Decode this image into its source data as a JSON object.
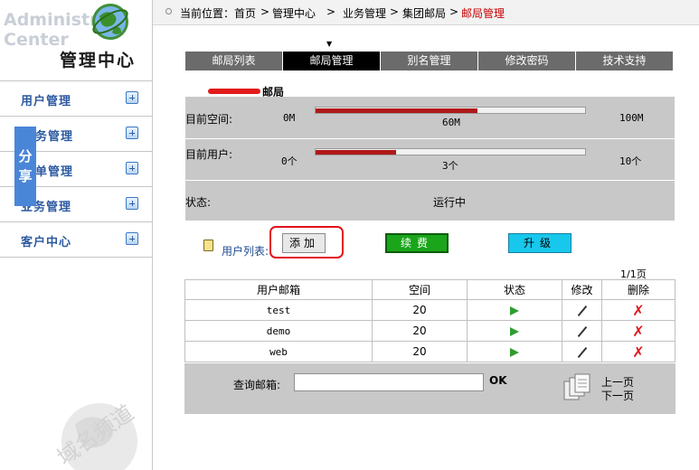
{
  "sidebar": {
    "logo_text_line1": "Administr",
    "logo_text_line2": "Center",
    "logo_title": "管理中心",
    "items": [
      {
        "label": "用户管理"
      },
      {
        "label": "务管理"
      },
      {
        "label": "单管理"
      },
      {
        "label": "业务管理"
      },
      {
        "label": "客户中心"
      }
    ],
    "share_label_1": "分",
    "share_label_2": "享",
    "watermark_text": "域名频道"
  },
  "breadcrumb": {
    "prefix": "当前位置：",
    "items": [
      "首页",
      "管理中心",
      "业务管理",
      "集团邮局"
    ],
    "separator": ">",
    "current": "邮局管理"
  },
  "tabs": [
    {
      "label": "邮局列表",
      "active": false
    },
    {
      "label": "邮局管理",
      "active": true
    },
    {
      "label": "别名管理",
      "active": false
    },
    {
      "label": "修改密码",
      "active": false
    },
    {
      "label": "技术支持",
      "active": false
    }
  ],
  "post_office": {
    "name_suffix": "邮局",
    "space_label": "目前空间:",
    "space_min": "0M",
    "space_used": "60M",
    "space_max": "100M",
    "space_fill": 0.6,
    "users_label": "目前用户:",
    "users_min": "0个",
    "users_used": "3个",
    "users_max": "10个",
    "users_fill": 0.3,
    "status_label": "状态:",
    "status_value": "运行中"
  },
  "actions": {
    "user_list_label": "用户列表:",
    "add_label": "添加",
    "renew_label": "续费",
    "upgrade_label": "升级"
  },
  "pager": "1/1页",
  "table": {
    "headers": [
      "用户邮箱",
      "空间",
      "状态",
      "修改",
      "删除"
    ],
    "rows": [
      {
        "email": "test",
        "space": "20"
      },
      {
        "email": "demo",
        "space": "20"
      },
      {
        "email": "web",
        "space": "20"
      }
    ]
  },
  "query": {
    "label": "查询邮箱:",
    "value": "",
    "ok_label": "OK",
    "prev_label": "上一页",
    "next_label": "下一页"
  },
  "colors": {
    "active_crumb": "#c40000",
    "tab_bg": "#6b6b6b",
    "tab_active_bg": "#000000",
    "panel_bg": "#c8c8c8",
    "renew_bg": "#1aa51a",
    "upgrade_bg": "#18c7ec",
    "highlight": "#e3121c"
  }
}
